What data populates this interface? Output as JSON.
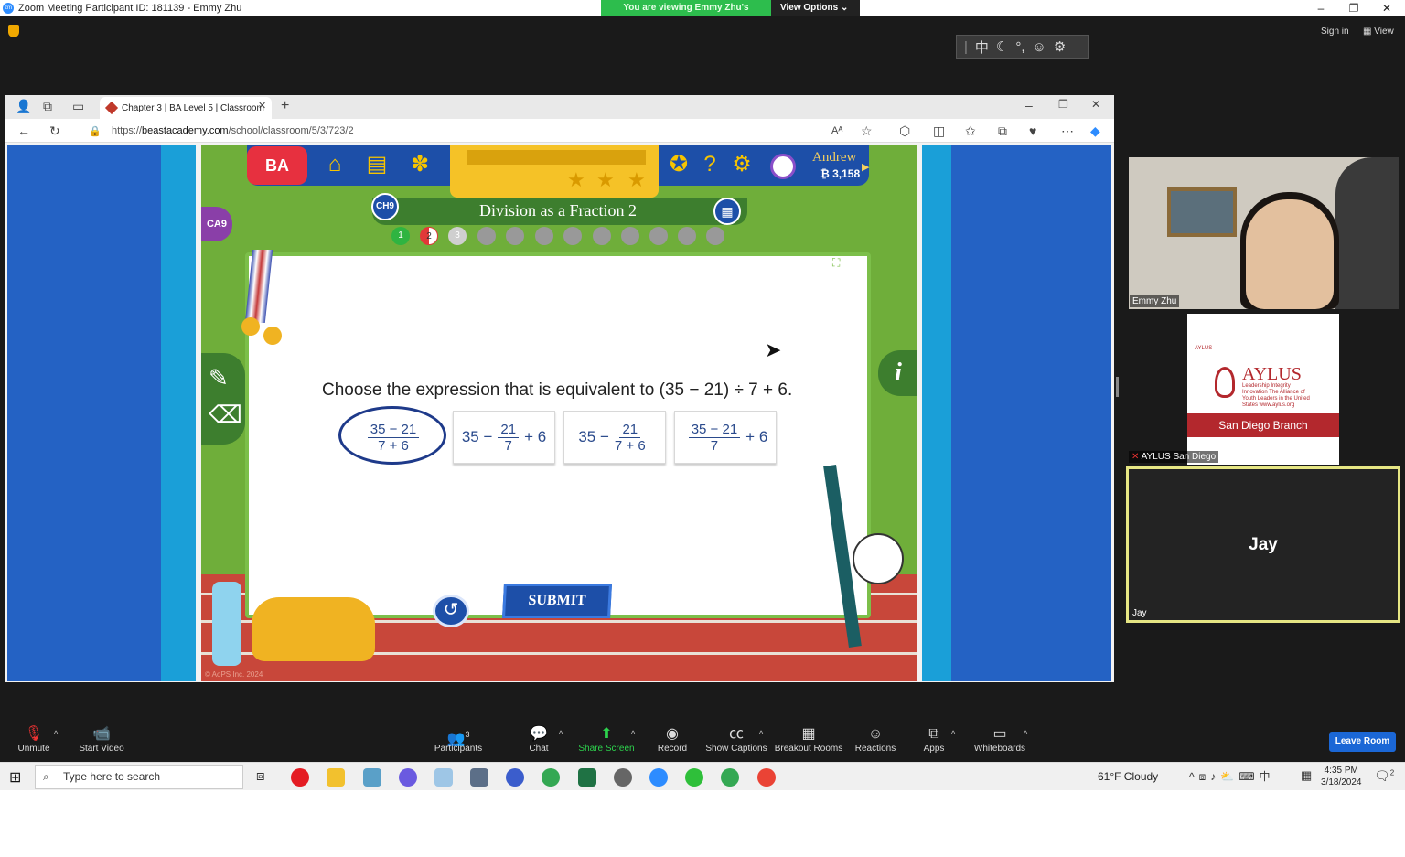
{
  "zoom": {
    "window_title": "Zoom Meeting Participant ID: 181139 - Emmy Zhu",
    "viewing_banner": "You are viewing Emmy Zhu's screen",
    "view_options": "View Options",
    "sign_in": "Sign in",
    "view": "View"
  },
  "browser": {
    "tab_title": "Chapter 3 | BA Level 5 | Classroom",
    "url_prefix": "https://",
    "url_domain": "beastacademy.com",
    "url_path": "/school/classroom/5/3/723/2"
  },
  "game": {
    "logo": "BA",
    "user_name": "Andrew",
    "bucks": "₿ 3,158",
    "chapter_badge": "CH9",
    "side_badge": "CA9",
    "lesson_title": "Division as a Fraction 2",
    "progress_dots": [
      "1",
      "2",
      "3"
    ],
    "question": "Choose the expression that is equivalent to (35 − 21) ÷ 7 + 6.",
    "choices": [
      {
        "whole": "",
        "num": "35 − 21",
        "den": "7 + 6",
        "suffix": ""
      },
      {
        "whole": "35 −",
        "num": "21",
        "den": "7",
        "suffix": "+ 6"
      },
      {
        "whole": "35 −",
        "num": "21",
        "den": "7 + 6",
        "suffix": ""
      },
      {
        "whole": "",
        "num": "35 − 21",
        "den": "7",
        "suffix": "+ 6"
      }
    ],
    "submit": "SUBMIT",
    "copyright": "© AoPS Inc. 2024",
    "info": "i"
  },
  "participants": {
    "emmy": "Emmy Zhu",
    "aylus": "AYLUS San Diego",
    "jay_tile": "Jay",
    "jay_label": "Jay"
  },
  "aylus_card": {
    "small": "AYLUS",
    "title": "AYLUS",
    "sub": "Leadership Integrity Innovation The Alliance of Youth Leaders in the United States www.aylus.org",
    "branch": "San Diego Branch"
  },
  "toolbar": {
    "unmute": "Unmute",
    "start_video": "Start Video",
    "participants_count": "3",
    "participants": "Participants",
    "chat": "Chat",
    "share_screen": "Share Screen",
    "record": "Record",
    "show_captions": "Show Captions",
    "breakout_rooms": "Breakout Rooms",
    "reactions": "Reactions",
    "apps": "Apps",
    "whiteboards": "Whiteboards",
    "leave": "Leave Room"
  },
  "taskbar": {
    "search_placeholder": "Type here to search",
    "weather": "61°F  Cloudy",
    "time": "4:35 PM",
    "date": "3/18/2024",
    "notif": "2"
  },
  "colors": {
    "zoom_green": "#2dbd4d",
    "ba_blue": "#1d4fa8",
    "ba_red": "#e7303f",
    "ba_yellow": "#f5c227",
    "leave_blue": "#1b67d6",
    "aylus_red": "#b3282d"
  }
}
